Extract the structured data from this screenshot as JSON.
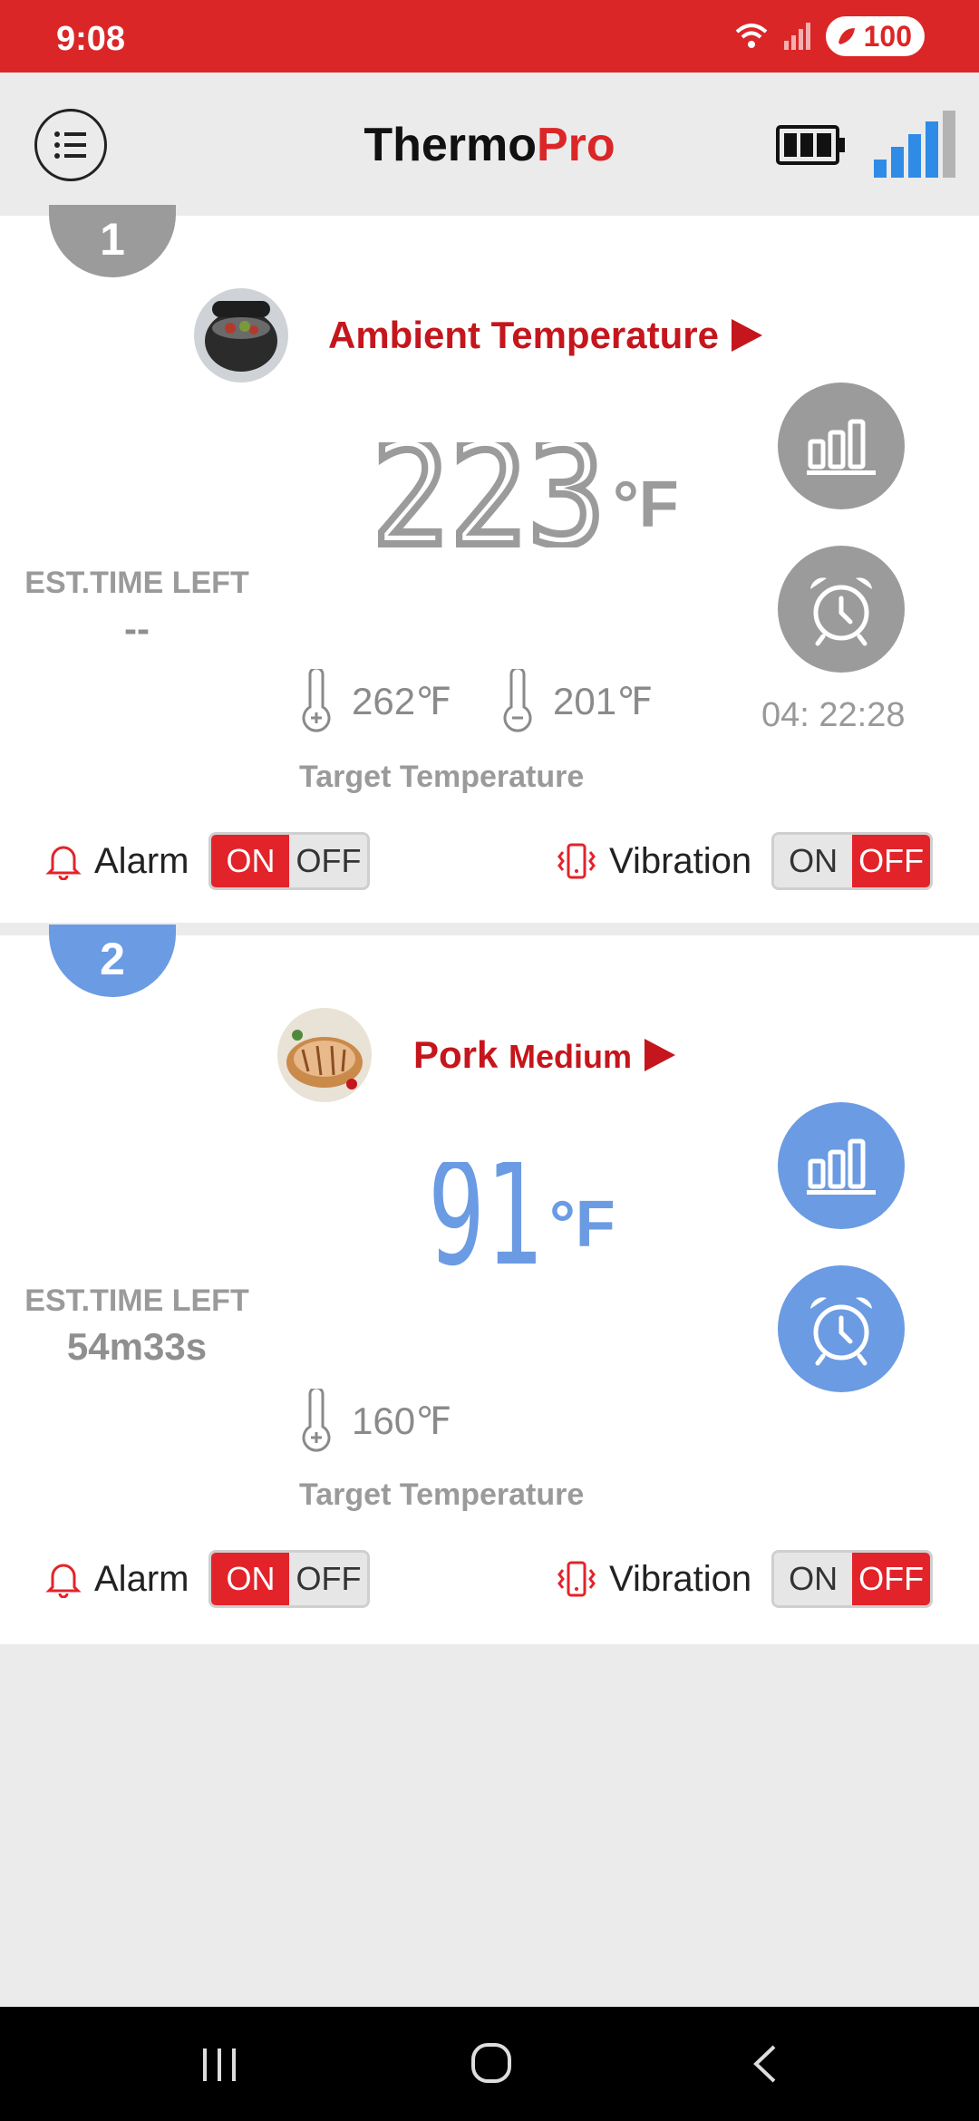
{
  "status": {
    "time": "9:08",
    "battery": "100"
  },
  "header": {
    "title_main": "Thermo",
    "title_accent": "Pro"
  },
  "colors": {
    "accent": "#db2627",
    "probe1": "#9b9b9b",
    "probe2": "#6b9be3"
  },
  "probes": [
    {
      "number": "1",
      "food_name": "Ambient Temperature",
      "temp": "223",
      "unit": "°F",
      "est_label": "EST.TIME LEFT",
      "est_value": "--",
      "high_target": "262℉",
      "low_target": "201℉",
      "target_label": "Target Temperature",
      "timer": "04:  22:28",
      "alarm_label": "Alarm",
      "vibration_label": "Vibration",
      "on_label": "ON",
      "off_label": "OFF"
    },
    {
      "number": "2",
      "food_name": "Pork",
      "food_doneness": "Medium",
      "temp": "91",
      "unit": "°F",
      "est_label": "EST.TIME LEFT",
      "est_value": "54m33s",
      "high_target": "160℉",
      "target_label": "Target Temperature",
      "alarm_label": "Alarm",
      "vibration_label": "Vibration",
      "on_label": "ON",
      "off_label": "OFF"
    }
  ]
}
